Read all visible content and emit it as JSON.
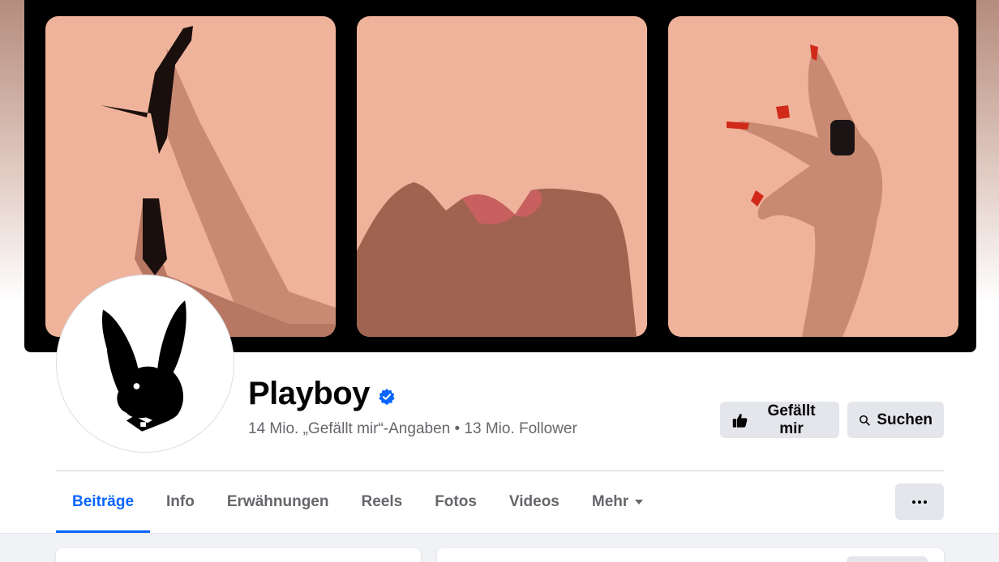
{
  "profile": {
    "name": "Playboy",
    "verified": true,
    "stats": "14 Mio. „Gefällt mir“-Angaben • 13 Mio. Follower"
  },
  "actions": {
    "like_label": "Gefällt mir",
    "search_label": "Suchen"
  },
  "tabs": [
    {
      "label": "Beiträge",
      "active": true
    },
    {
      "label": "Info",
      "active": false
    },
    {
      "label": "Erwähnungen",
      "active": false
    },
    {
      "label": "Reels",
      "active": false
    },
    {
      "label": "Fotos",
      "active": false
    },
    {
      "label": "Videos",
      "active": false
    },
    {
      "label": "Mehr",
      "active": false
    }
  ],
  "icons": {
    "verified": "verified-badge-icon",
    "like": "thumbs-up-icon",
    "search": "search-icon",
    "more_tab": "caret-down-icon",
    "overflow": "ellipsis-icon"
  },
  "colors": {
    "accent": "#0866ff",
    "verified": "#0866ff",
    "cover_peach": "#efb39b",
    "button_bg": "#e4e6eb",
    "secondary_text": "#65676b"
  }
}
